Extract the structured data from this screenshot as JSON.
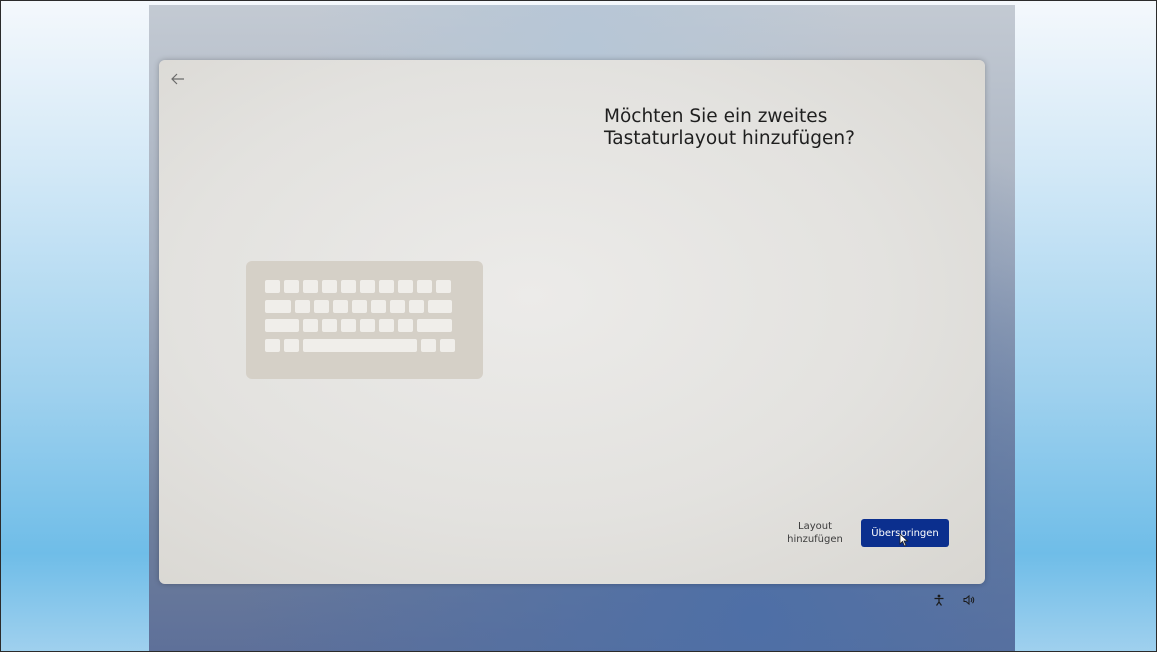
{
  "setup": {
    "title": "Möchten Sie ein zweites Tastaturlayout hinzufügen?",
    "back_icon": "arrow-left-icon",
    "illustration": "keyboard-icon",
    "add_layout_label": "Layout hinzufügen",
    "skip_label": "Überspringen"
  },
  "tray": {
    "accessibility_icon": "accessibility-icon",
    "volume_icon": "volume-icon"
  },
  "colors": {
    "primary_button": "#0b2f8e",
    "card_background": "#e6e5e2",
    "keyboard_body": "#d5d0c7"
  }
}
